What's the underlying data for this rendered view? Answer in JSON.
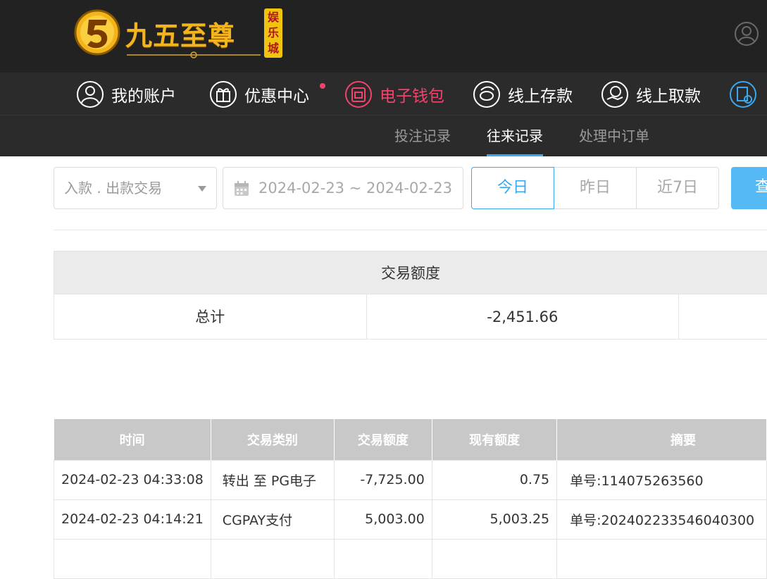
{
  "brand": {
    "name": "九五至尊",
    "badge": [
      "娱",
      "乐",
      "城"
    ]
  },
  "nav": {
    "items": [
      {
        "label": "我的账户",
        "icon": "user-circle-icon"
      },
      {
        "label": "优惠中心",
        "icon": "gift-icon",
        "has_dot": true
      },
      {
        "label": "电子钱包",
        "icon": "wallet-icon",
        "active": true
      },
      {
        "label": "线上存款",
        "icon": "deposit-icon"
      },
      {
        "label": "线上取款",
        "icon": "withdraw-icon"
      }
    ]
  },
  "subnav": {
    "tabs": [
      {
        "label": "投注记录"
      },
      {
        "label": "往来记录",
        "active": true
      },
      {
        "label": "处理中订单"
      }
    ]
  },
  "filters": {
    "type_select": "入款 . 出款交易",
    "date_range": "2024-02-23 ~ 2024-02-23",
    "quick": [
      "今日",
      "昨日",
      "近7日"
    ],
    "quick_active": "今日",
    "search_label": "查"
  },
  "summary": {
    "header": "交易额度",
    "row_label": "总计",
    "total": "-2,451.66"
  },
  "table": {
    "columns": [
      "时间",
      "交易类别",
      "交易额度",
      "现有额度",
      "摘要"
    ],
    "rows": [
      [
        "2024-02-23 04:33:08",
        "转出 至 PG电子",
        "-7,725.00",
        "0.75",
        "单号:114075263560"
      ],
      [
        "2024-02-23 04:14:21",
        "CGPAY支付",
        "5,003.00",
        "5,003.25",
        "单号:202402233546040300"
      ]
    ]
  },
  "colors": {
    "header_bg": "#222222",
    "nav_bg": "#2b2b2b",
    "active_pink": "#f0446c",
    "accent_blue": "#3aa8f0",
    "gold": "#f2b51f"
  }
}
